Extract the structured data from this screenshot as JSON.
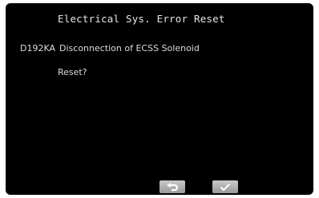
{
  "screen": {
    "title": "Electrical Sys. Error Reset",
    "error_code": "D192KA",
    "error_description": "Disconnection of ECSS Solenoid",
    "prompt": "Reset?"
  },
  "buttons": {
    "back_icon": "undo-arrow-icon",
    "confirm_icon": "checkmark-icon"
  },
  "colors": {
    "screen_background": "#000000",
    "text": "#e6e6e6",
    "button_face": "#b5b5b5"
  }
}
